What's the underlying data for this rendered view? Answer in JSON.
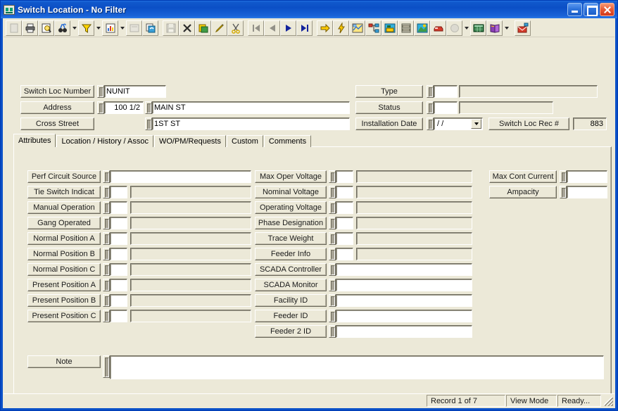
{
  "window": {
    "title": "Switch Location - No Filter",
    "icon": "app-icon",
    "buttons": {
      "minimize": "minimize",
      "maximize": "maximize",
      "close": "close"
    }
  },
  "toolbar": {
    "groups": [
      [
        {
          "name": "new-record-icon",
          "glyph": "blank-page",
          "disabled": true
        },
        {
          "name": "print-icon",
          "glyph": "printer",
          "disabled": false
        },
        {
          "name": "print-preview-icon",
          "glyph": "preview",
          "disabled": false
        },
        {
          "name": "find-icon",
          "glyph": "binoculars",
          "disabled": false,
          "dropdown": true
        },
        {
          "name": "filter-icon",
          "glyph": "funnel",
          "disabled": false,
          "dropdown": true
        },
        {
          "name": "report-icon",
          "glyph": "chart-page",
          "disabled": false,
          "dropdown": true
        },
        {
          "name": "properties-icon",
          "glyph": "properties",
          "disabled": true
        },
        {
          "name": "refresh-icon",
          "glyph": "refresh-pages",
          "disabled": false
        }
      ],
      [
        {
          "name": "save-icon",
          "glyph": "floppy",
          "disabled": true
        },
        {
          "name": "delete-icon",
          "glyph": "x-mark",
          "disabled": false
        },
        {
          "name": "paste-icon",
          "glyph": "paste",
          "disabled": false
        },
        {
          "name": "edit-icon",
          "glyph": "pencil",
          "disabled": false
        },
        {
          "name": "cut-icon",
          "glyph": "scissors",
          "disabled": false
        }
      ],
      [
        {
          "name": "first-record-icon",
          "glyph": "first",
          "disabled": true
        },
        {
          "name": "previous-record-icon",
          "glyph": "prev",
          "disabled": true
        },
        {
          "name": "next-record-icon",
          "glyph": "next",
          "disabled": false
        },
        {
          "name": "last-record-icon",
          "glyph": "last",
          "disabled": false
        }
      ],
      [
        {
          "name": "goto-icon",
          "glyph": "yellow-arrow",
          "disabled": false
        },
        {
          "name": "quick-action-icon",
          "glyph": "lightning",
          "disabled": false
        },
        {
          "name": "map-icon",
          "glyph": "map",
          "disabled": false
        },
        {
          "name": "hierarchy-icon",
          "glyph": "tree",
          "disabled": false
        },
        {
          "name": "work-order-icon",
          "glyph": "workorder",
          "disabled": false
        },
        {
          "name": "inventory-icon",
          "glyph": "cabinet",
          "disabled": false
        },
        {
          "name": "asset-icon",
          "glyph": "asset",
          "disabled": false
        },
        {
          "name": "vehicle-icon",
          "glyph": "vehicle",
          "disabled": false
        },
        {
          "name": "search-globe-icon",
          "glyph": "globe",
          "disabled": true,
          "dropdown": true
        },
        {
          "name": "grid-view-icon",
          "glyph": "grid",
          "disabled": false
        },
        {
          "name": "help-book-icon",
          "glyph": "book",
          "disabled": false,
          "dropdown": true
        },
        {
          "name": "mail-icon",
          "glyph": "mail",
          "disabled": false
        }
      ]
    ]
  },
  "header": {
    "switch_loc_number": {
      "label": "Switch Loc Number",
      "value": "NUNIT"
    },
    "address": {
      "label": "Address",
      "number": "100 1/2",
      "street": "MAIN ST"
    },
    "cross_street": {
      "label": "Cross Street",
      "value": "1ST ST"
    },
    "type": {
      "label": "Type",
      "code": "",
      "description": ""
    },
    "status": {
      "label": "Status",
      "code": "",
      "description": ""
    },
    "installation_date": {
      "label": "Installation Date",
      "value": "/  /"
    },
    "switch_loc_rec": {
      "label": "Switch Loc Rec #",
      "value": "883"
    }
  },
  "tabs": [
    {
      "label": "Attributes",
      "active": true
    },
    {
      "label": "Location / History / Assoc",
      "active": false
    },
    {
      "label": "WO/PM/Requests",
      "active": false
    },
    {
      "label": "Custom",
      "active": false
    },
    {
      "label": "Comments",
      "active": false
    }
  ],
  "attributes": {
    "left_column": [
      {
        "label": "Perf Circuit Source",
        "code": "",
        "description": "",
        "wide": true
      },
      {
        "label": "Tie Switch Indicat",
        "code": "",
        "description": "",
        "wide": false
      },
      {
        "label": "Manual Operation",
        "code": "",
        "description": "",
        "wide": false
      },
      {
        "label": "Gang Operated",
        "code": "",
        "description": "",
        "wide": false
      },
      {
        "label": "Normal Position A",
        "code": "",
        "description": "",
        "wide": false
      },
      {
        "label": "Normal Position B",
        "code": "",
        "description": "",
        "wide": false
      },
      {
        "label": "Normal Position C",
        "code": "",
        "description": "",
        "wide": false
      },
      {
        "label": "Present Position A",
        "code": "",
        "description": "",
        "wide": false
      },
      {
        "label": "Present Position B",
        "code": "",
        "description": "",
        "wide": false
      },
      {
        "label": "Present Position C",
        "code": "",
        "description": "",
        "wide": false
      }
    ],
    "middle_column": [
      {
        "label": "Max Oper Voltage",
        "code": "",
        "description": "",
        "wide": false
      },
      {
        "label": "Nominal Voltage",
        "code": "",
        "description": "",
        "wide": false
      },
      {
        "label": "Operating Voltage",
        "code": "",
        "description": "",
        "wide": false
      },
      {
        "label": "Phase Designation",
        "code": "",
        "description": "",
        "wide": false
      },
      {
        "label": "Trace Weight",
        "code": "",
        "description": "",
        "wide": false
      },
      {
        "label": "Feeder Info",
        "code": "",
        "description": "",
        "wide": false
      },
      {
        "label": "SCADA Controller",
        "code": "",
        "description": "",
        "wide": true
      },
      {
        "label": "SCADA Monitor",
        "code": "",
        "description": "",
        "wide": true
      },
      {
        "label": "Facility ID",
        "code": "",
        "description": "",
        "wide": true
      },
      {
        "label": "Feeder ID",
        "code": "",
        "description": "",
        "wide": true
      },
      {
        "label": "Feeder 2 ID",
        "code": "",
        "description": "",
        "wide": true
      }
    ],
    "right_column": [
      {
        "label": "Max Cont Current",
        "value": ""
      },
      {
        "label": "Ampacity",
        "value": ""
      }
    ],
    "note": {
      "label": "Note",
      "value": ""
    }
  },
  "statusbar": {
    "record": "Record 1 of 7",
    "mode": "View Mode",
    "state": "Ready..."
  },
  "colors": {
    "titlebar": "#0b4fc6",
    "face": "#ece9d8",
    "field": "#ffffff",
    "accent_yellow": "#ffcc00"
  }
}
